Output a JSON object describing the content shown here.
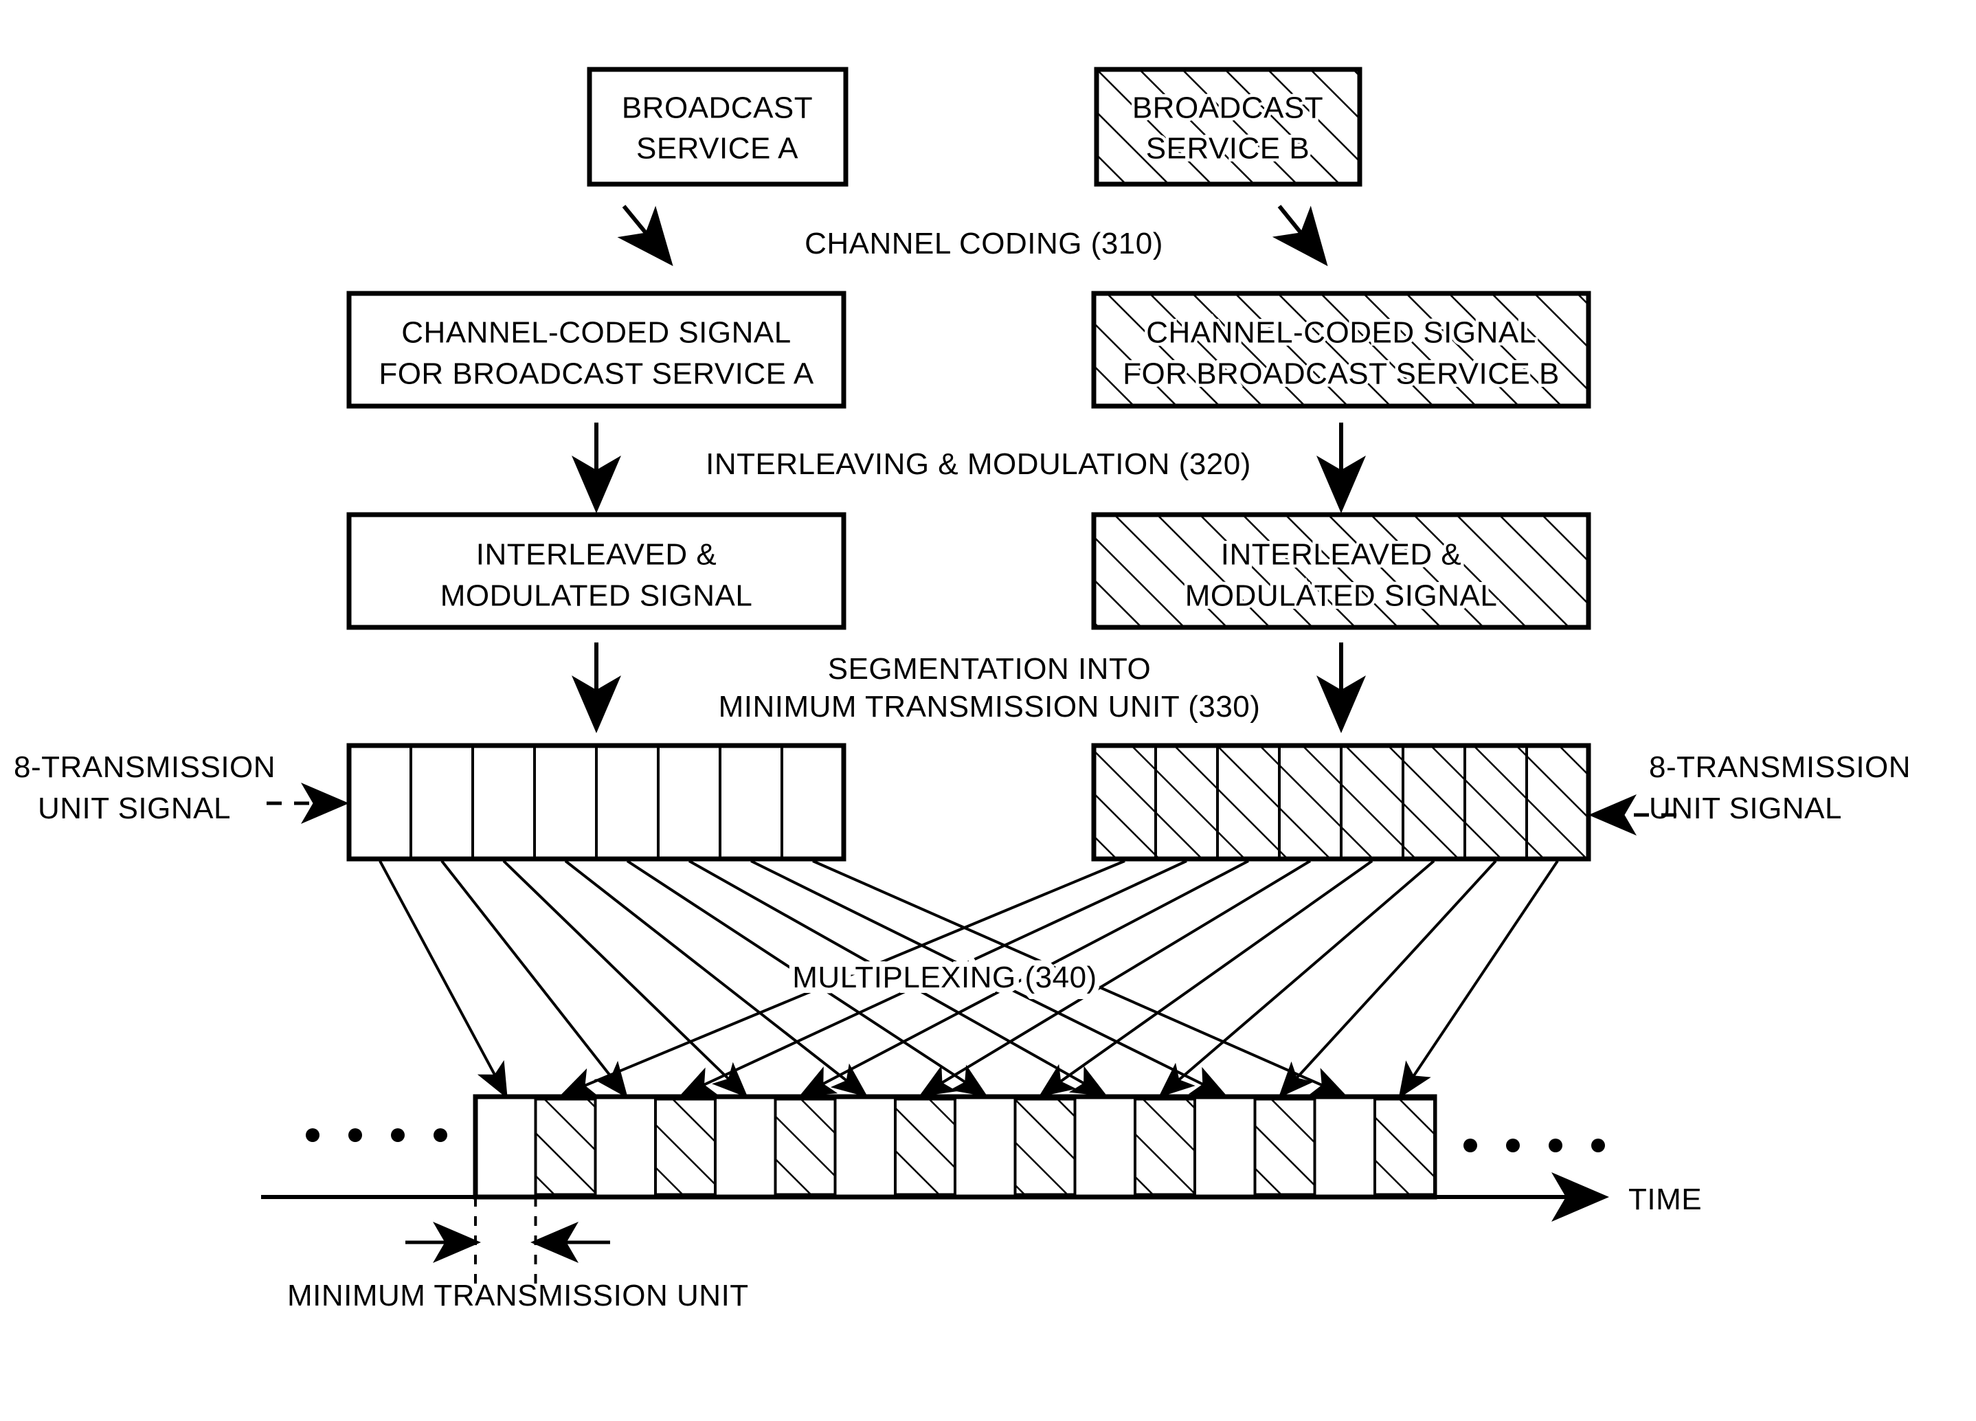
{
  "figure": {
    "title_hidden": "",
    "source_boxes": [
      {
        "id": "service-a",
        "line1": "BROADCAST",
        "line2": "SERVICE A",
        "hatched": false
      },
      {
        "id": "service-b",
        "line1": "BROADCAST",
        "line2": "SERVICE B",
        "hatched": true
      }
    ],
    "coded_boxes": [
      {
        "id": "coded-a",
        "line1": "CHANNEL-CODED SIGNAL",
        "line2": "FOR BROADCAST SERVICE A",
        "hatched": false
      },
      {
        "id": "coded-b",
        "line1": "CHANNEL-CODED SIGNAL",
        "line2": "FOR BROADCAST SERVICE B",
        "hatched": true
      }
    ],
    "modulated_boxes": [
      {
        "id": "mod-a",
        "line1": "INTERLEAVED &",
        "line2": "MODULATED SIGNAL",
        "hatched": false
      },
      {
        "id": "mod-b",
        "line1": "INTERLEAVED &",
        "line2": "MODULATED SIGNAL",
        "hatched": true
      }
    ],
    "process_labels": {
      "channel_coding": "CHANNEL CODING (310)",
      "interleaving_modulation": "INTERLEAVING & MODULATION (320)",
      "segmentation_line1": "SEGMENTATION INTO",
      "segmentation_line2": "MINIMUM TRANSMISSION UNIT (330)",
      "multiplexing": "MULTIPLEXING (340)"
    },
    "unit_signal_labels": {
      "left_line1": "8-TRANSMISSION",
      "left_line2": "UNIT SIGNAL",
      "right_line1": "8-TRANSMISSION",
      "right_line2": "UNIT SIGNAL"
    },
    "unit_blocks": {
      "cells_per_block": 8,
      "left_hatched": false,
      "right_hatched": true
    },
    "multiplexed_stream": {
      "cell_count": 16,
      "pattern": [
        "A",
        "B",
        "A",
        "B",
        "A",
        "B",
        "A",
        "B",
        "A",
        "B",
        "A",
        "B",
        "A",
        "B",
        "A",
        "B"
      ],
      "left_ellipsis": "• • • •",
      "right_ellipsis": "• • • •"
    },
    "axis": {
      "time_label": "TIME"
    },
    "min_unit_label": "MINIMUM TRANSMISSION UNIT",
    "colors": {
      "ink": "#000000",
      "paper": "#ffffff"
    }
  }
}
